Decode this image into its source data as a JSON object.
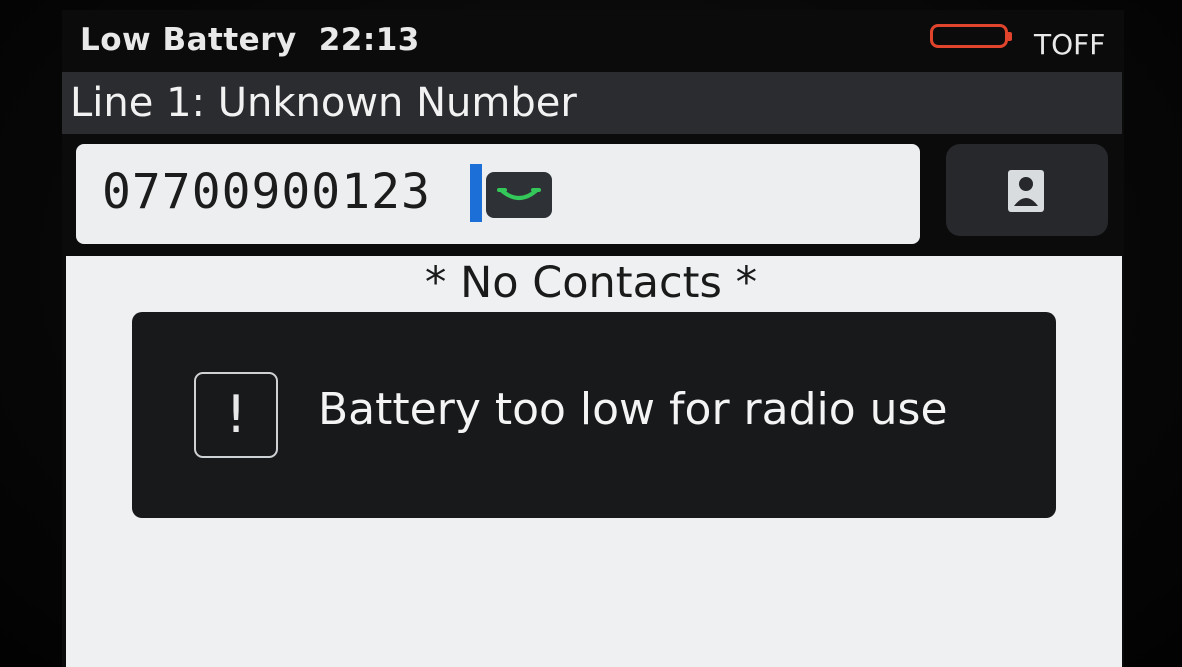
{
  "status_bar": {
    "mode": "Low Battery",
    "time": "22:13",
    "battery_level": "low",
    "tx_status": "TOFF"
  },
  "line_header": {
    "title": "Line 1: Unknown Number"
  },
  "dial_input": {
    "value": "07700900123"
  },
  "contacts": {
    "empty_text": "* No Contacts *"
  },
  "alert": {
    "icon_symbol": "!",
    "message": "Battery too low for radio use"
  },
  "colors": {
    "battery_low": "#e0442c",
    "call_key_green": "#34c759",
    "cursor_blue": "#1b6fd6"
  },
  "icons": {
    "call": "call-icon",
    "contact": "contact-icon",
    "alert": "exclamation-icon"
  }
}
